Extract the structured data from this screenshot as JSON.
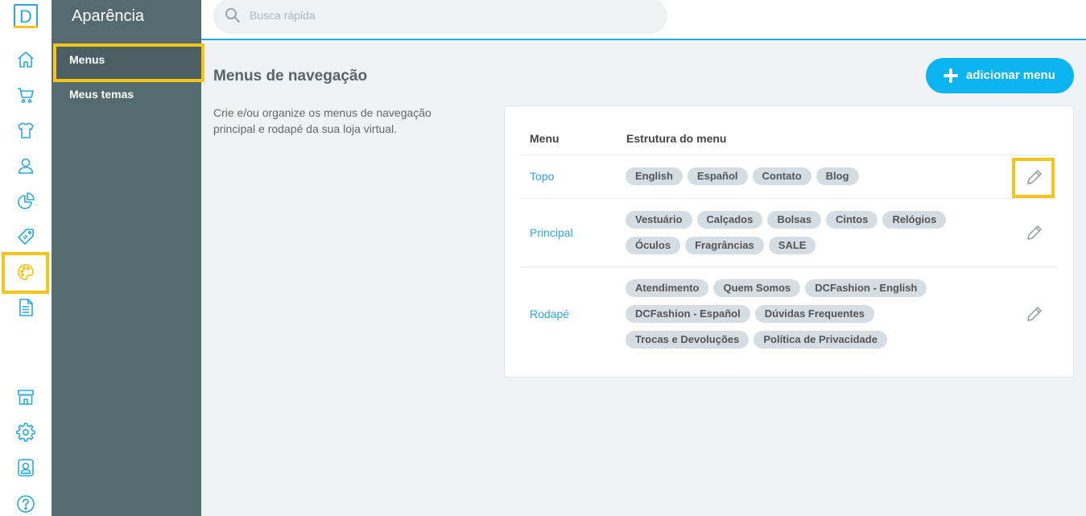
{
  "app": {
    "logo_letter": "D"
  },
  "rail": {
    "icons": [
      "home-icon",
      "cart-icon",
      "shirt-icon",
      "user-icon",
      "chart-pie-icon",
      "tag-icon",
      "palette-icon",
      "document-icon",
      "store-icon",
      "gear-icon",
      "profile-icon",
      "help-icon"
    ],
    "active": "palette-icon"
  },
  "subnav": {
    "title": "Aparência",
    "items": [
      {
        "label": "Menus",
        "active": true
      },
      {
        "label": "Meus temas",
        "active": false
      }
    ]
  },
  "search": {
    "placeholder": "Busca rápida",
    "value": ""
  },
  "main": {
    "title": "Menus de navegação",
    "description": "Crie e/ou organize os menus de navegação principal e rodapé da sua loja virtual.",
    "add_button": "adicionar menu"
  },
  "table": {
    "headers": {
      "menu": "Menu",
      "structure": "Estrutura do menu"
    },
    "rows": [
      {
        "name": "Topo",
        "items": [
          "English",
          "Español",
          "Contato",
          "Blog"
        ]
      },
      {
        "name": "Principal",
        "items": [
          "Vestuário",
          "Calçados",
          "Bolsas",
          "Cintos",
          "Relógios",
          "Óculos",
          "Fragrâncias",
          "SALE"
        ]
      },
      {
        "name": "Rodapé",
        "items": [
          "Atendimento",
          "Quem Somos",
          "DCFashion - English",
          "DCFashion - Español",
          "Dúvidas Frequentes",
          "Trocas e Devoluções",
          "Política de Privacidade"
        ]
      }
    ]
  },
  "colors": {
    "accent": "#29a8e0",
    "button": "#0ab4f0",
    "sidebar": "#546a6e",
    "highlight": "#f5c518",
    "tag_bg": "#d4dde3"
  }
}
